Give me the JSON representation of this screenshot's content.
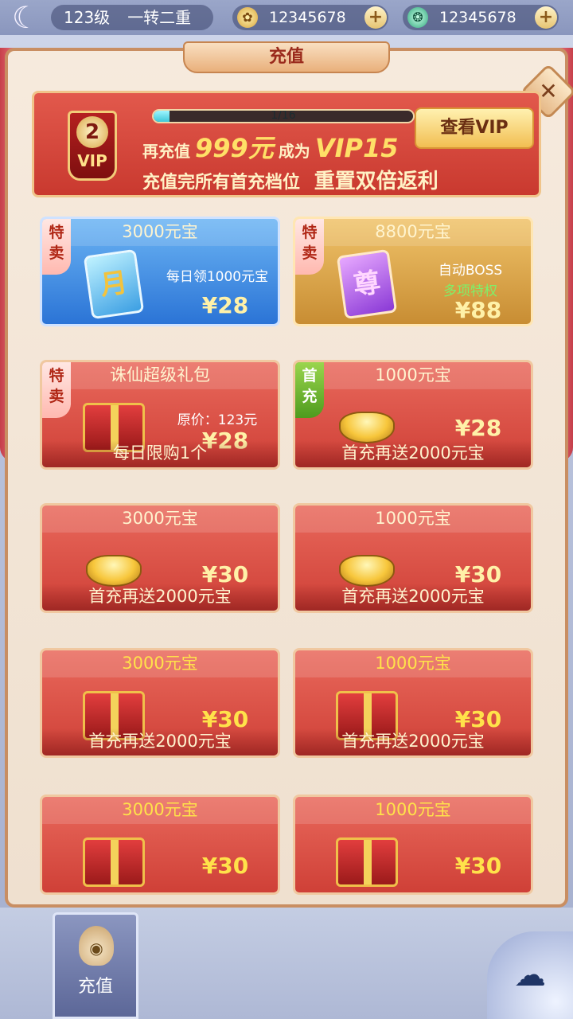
{
  "status_bar": {
    "level": "123级",
    "rank": "一转二重",
    "gold_amount": "12345678",
    "jade_amount": "12345678"
  },
  "window": {
    "title": "充值",
    "close_label": "✕"
  },
  "vip": {
    "level": "2",
    "badge_label": "VIP",
    "progress_text": "1/16",
    "progress_fraction": 0.0625,
    "line1_prefix": "再充值",
    "line1_amount": "999元",
    "line1_middle": "成为",
    "line1_target": "VIP15",
    "line2_part1": "充值完所有首充档位",
    "line2_part2": "重置双倍返利",
    "view_button": "查看VIP"
  },
  "products": [
    {
      "header": "3000元宝",
      "tag": "特\n卖",
      "desc1": "每日领1000元宝",
      "desc2": "",
      "price": "¥28",
      "footer": "",
      "icon": "月"
    },
    {
      "header": "8800元宝",
      "tag": "特\n卖",
      "desc1": "自动BOSS",
      "desc2": "多项特权",
      "price": "¥88",
      "footer": "",
      "icon": "尊"
    },
    {
      "header": "诛仙超级礼包",
      "tag": "特\n卖",
      "desc1": "原价：123元",
      "desc2": "",
      "price": "¥28",
      "footer": "每日限购1个",
      "icon": "gift"
    },
    {
      "header": "1000元宝",
      "tag": "首\n充",
      "desc1": "",
      "desc2": "",
      "price": "¥28",
      "footer": "首充再送2000元宝",
      "icon": "ingot"
    },
    {
      "header": "3000元宝",
      "price": "¥30",
      "footer": "首充再送2000元宝"
    },
    {
      "header": "1000元宝",
      "price": "¥30",
      "footer": "首充再送2000元宝"
    },
    {
      "header": "3000元宝",
      "price": "¥30",
      "footer": "首充再送2000元宝"
    },
    {
      "header": "1000元宝",
      "price": "¥30",
      "footer": "首充再送2000元宝"
    },
    {
      "header": "3000元宝",
      "price": "¥30"
    },
    {
      "header": "1000元宝",
      "price": "¥30"
    }
  ],
  "bottom_tab": {
    "label": "充值"
  },
  "colors": {
    "accent_red": "#cf4037",
    "gold_text": "#fff1a8",
    "highlight_yellow": "#ffe24a"
  }
}
